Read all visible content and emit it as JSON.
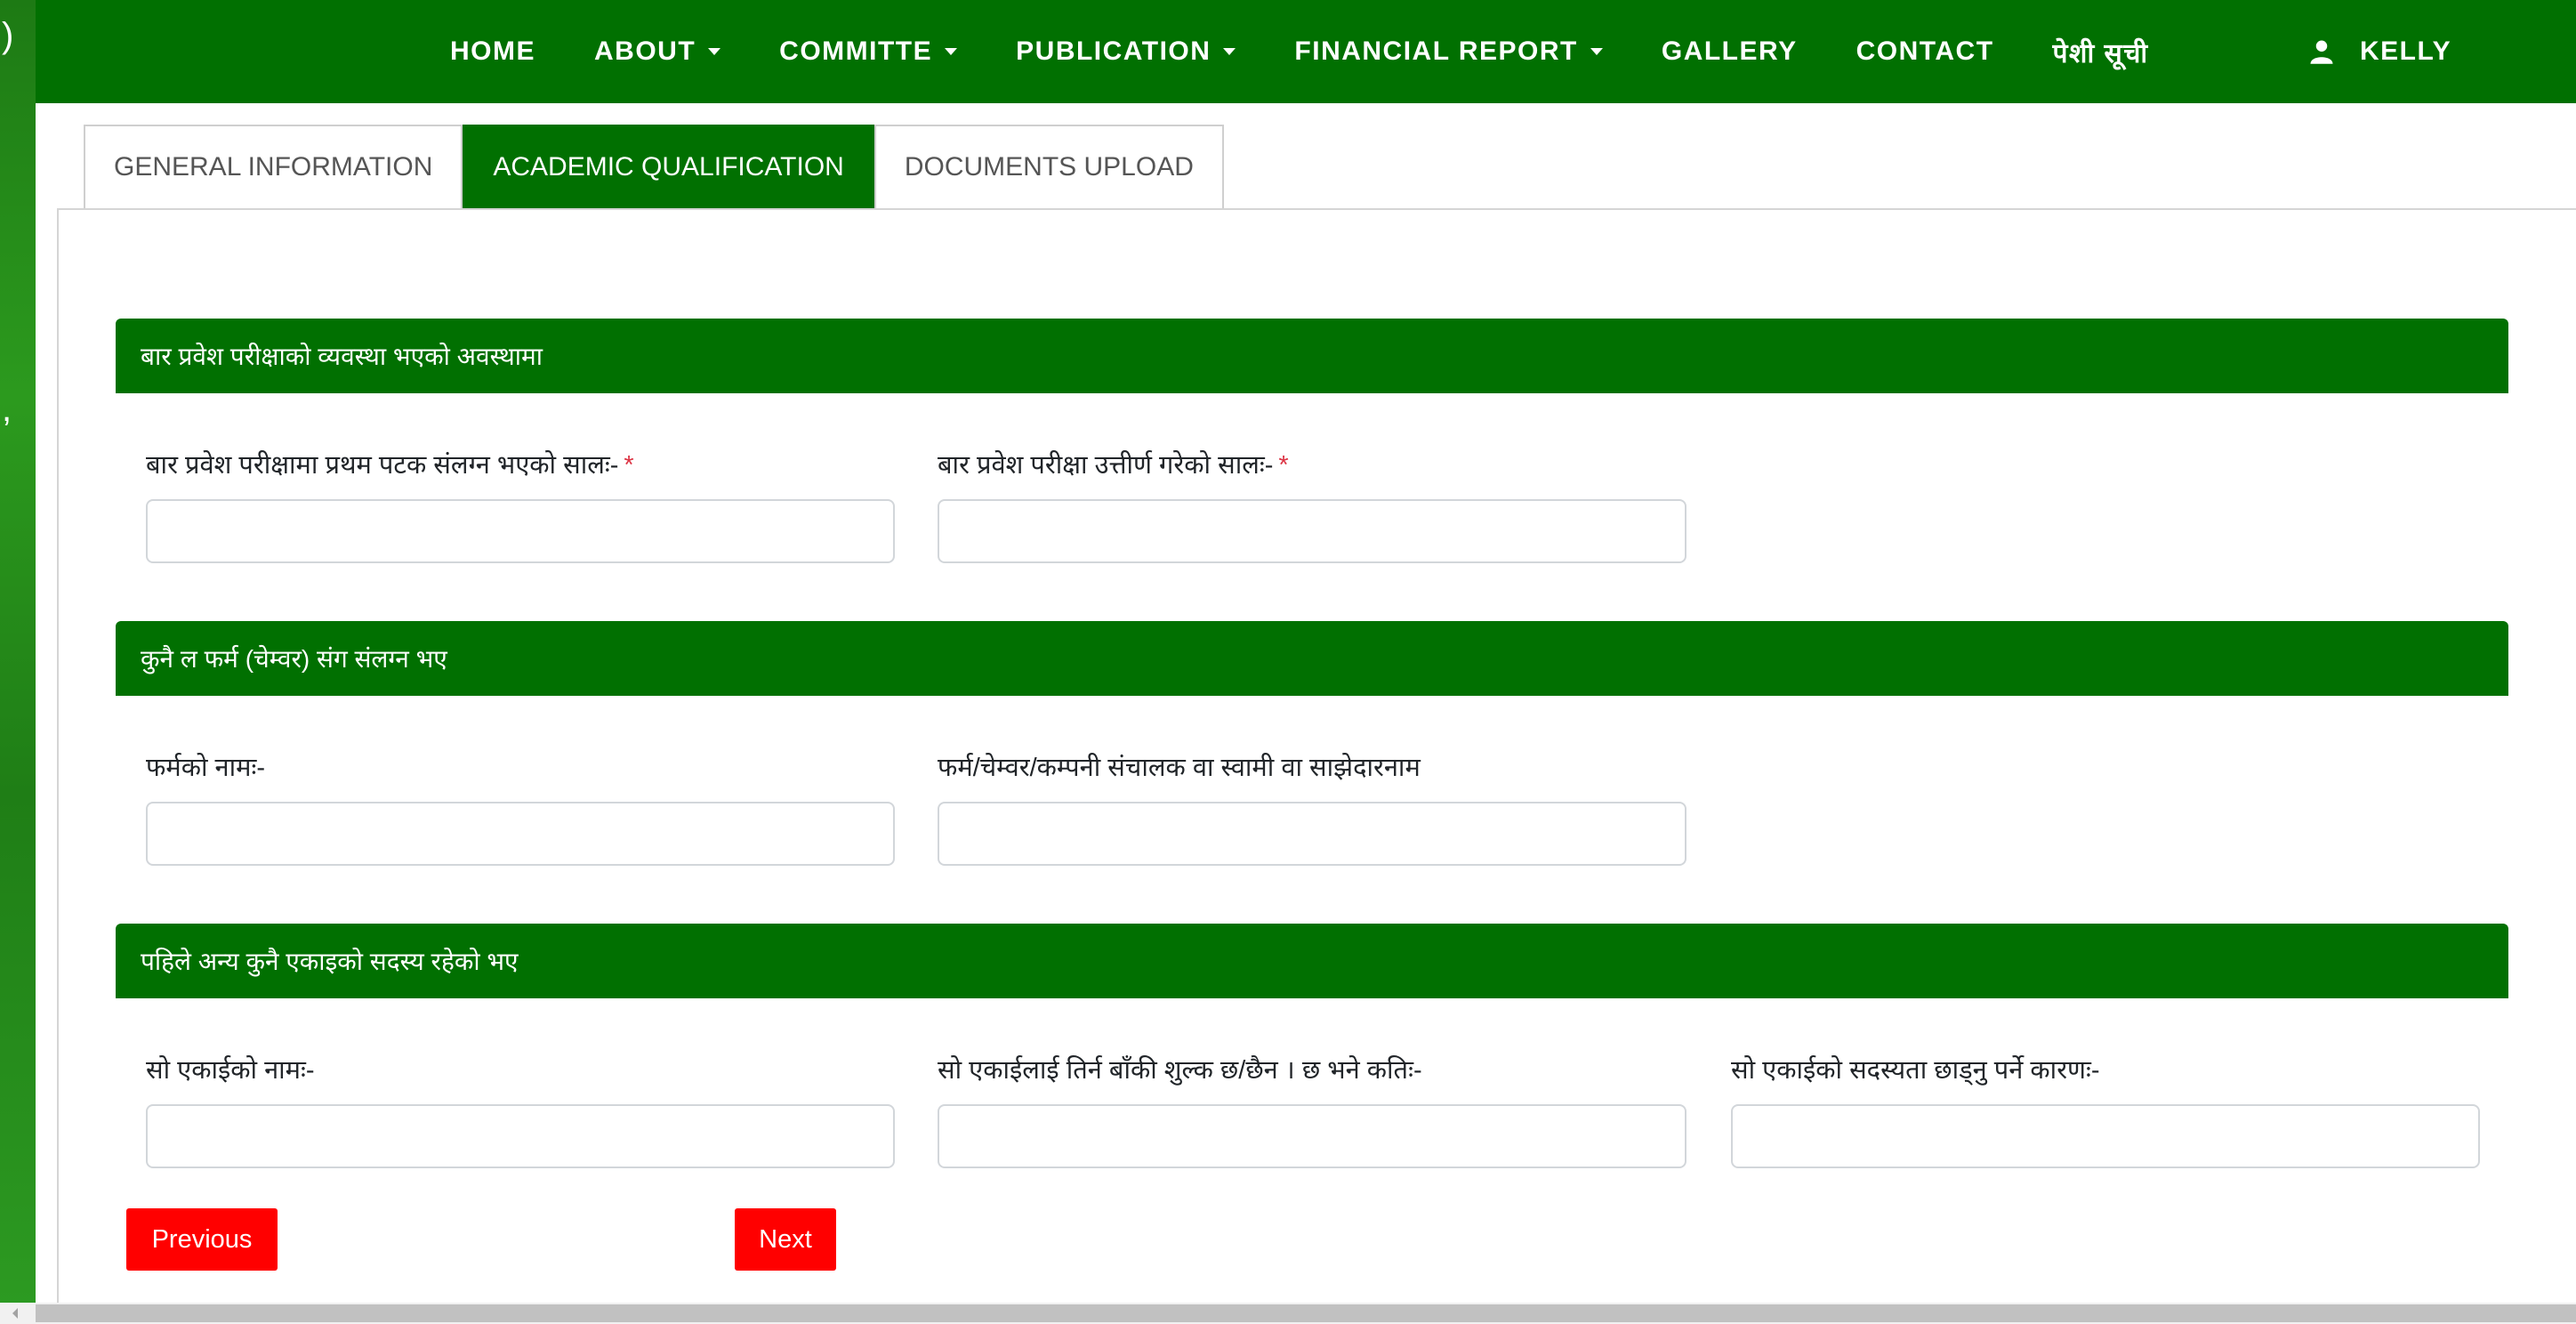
{
  "colors": {
    "brand_green": "#017001",
    "button_red": "#ff0000",
    "required_star": "#dc3545"
  },
  "left_strip": {
    "glyph_top": ")",
    "glyph_mid": ","
  },
  "nav": {
    "items": [
      {
        "label": "HOME",
        "dropdown": false
      },
      {
        "label": "ABOUT",
        "dropdown": true
      },
      {
        "label": "COMMITTE",
        "dropdown": true
      },
      {
        "label": "PUBLICATION",
        "dropdown": true
      },
      {
        "label": "FINANCIAL REPORT",
        "dropdown": true
      },
      {
        "label": "GALLERY",
        "dropdown": false
      },
      {
        "label": "CONTACT",
        "dropdown": false
      },
      {
        "label": "पेशी सूची",
        "dropdown": false
      }
    ],
    "user": {
      "icon": "user-icon",
      "label": "KELLY"
    }
  },
  "tabs": [
    {
      "label": "GENERAL INFORMATION",
      "active": false
    },
    {
      "label": "ACADEMIC QUALIFICATION",
      "active": true
    },
    {
      "label": "DOCUMENTS UPLOAD",
      "active": false
    }
  ],
  "sections": [
    {
      "title": "बार प्रवेश परीक्षाको व्यवस्था भएको अवस्थामा",
      "fields": [
        {
          "label": "बार प्रवेश परीक्षामा प्रथम पटक संलग्न भएको सालः-",
          "required": true,
          "value": ""
        },
        {
          "label": "बार प्रवेश परीक्षा उत्तीर्ण गरेको सालः-",
          "required": true,
          "value": ""
        }
      ]
    },
    {
      "title": "कुनै ल फर्म (चेम्वर) संग संलग्न भए",
      "fields": [
        {
          "label": "फर्मको नामः-",
          "required": false,
          "value": ""
        },
        {
          "label": "फर्म/चेम्वर/कम्पनी संचालक वा स्वामी वा साझेदारनाम",
          "required": false,
          "value": ""
        }
      ]
    },
    {
      "title": "पहिले अन्य कुनै एकाइको सदस्य रहेको भए",
      "fields": [
        {
          "label": "सो एकाईको नामः-",
          "required": false,
          "value": ""
        },
        {
          "label": "सो एकाईलाई तिर्न बाँकी शुल्क छ/छैन । छ भने कतिः-",
          "required": false,
          "value": ""
        },
        {
          "label": "सो एकाईको सदस्यता छाड्नु पर्ने कारणः-",
          "required": false,
          "value": ""
        }
      ]
    }
  ],
  "required_marker": "*",
  "buttons": {
    "previous_label": "Previous",
    "next_label": "Next"
  }
}
